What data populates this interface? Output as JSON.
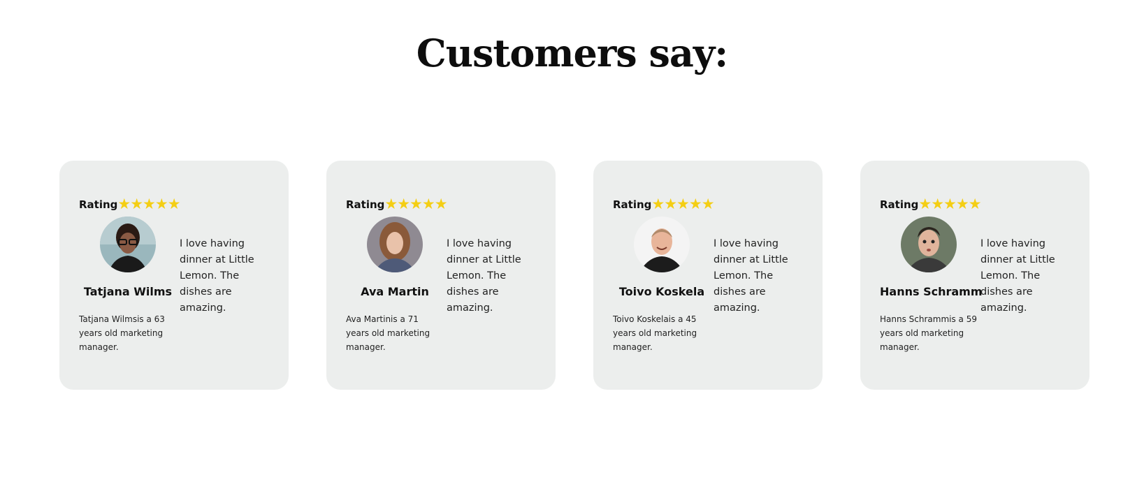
{
  "section": {
    "title": "Customers say:"
  },
  "testimonials": [
    {
      "rating_label": "Rating",
      "stars": "★★★★★",
      "avatar": "portrait-woman-glasses",
      "name": "Tatjana Wilms",
      "description": "Tatjana Wilmsis a 63 years old marketing manager.",
      "quote": "I love having dinner at Little Lemon. The dishes are amazing."
    },
    {
      "rating_label": "Rating",
      "stars": "★★★★★",
      "avatar": "portrait-woman-curly-hair",
      "name": "Ava Martin",
      "description": "Ava Martinis a 71 years old marketing manager.",
      "quote": "I love having dinner at Little Lemon. The dishes are amazing."
    },
    {
      "rating_label": "Rating",
      "stars": "★★★★★",
      "avatar": "portrait-man-smiling",
      "name": "Toivo Koskela",
      "description": "Toivo Koskelais a 45 years old marketing manager.",
      "quote": "I love having dinner at Little Lemon. The dishes are amazing."
    },
    {
      "rating_label": "Rating",
      "stars": "★★★★★",
      "avatar": "portrait-man-surprised",
      "name": "Hanns Schramm",
      "description": "Hanns Schrammis a 59 years old marketing manager.",
      "quote": "I love having dinner at Little Lemon. The dishes are amazing."
    }
  ],
  "colors": {
    "card_background": "#eceeed",
    "star_yellow": "#f4ce14",
    "text": "#111111"
  }
}
